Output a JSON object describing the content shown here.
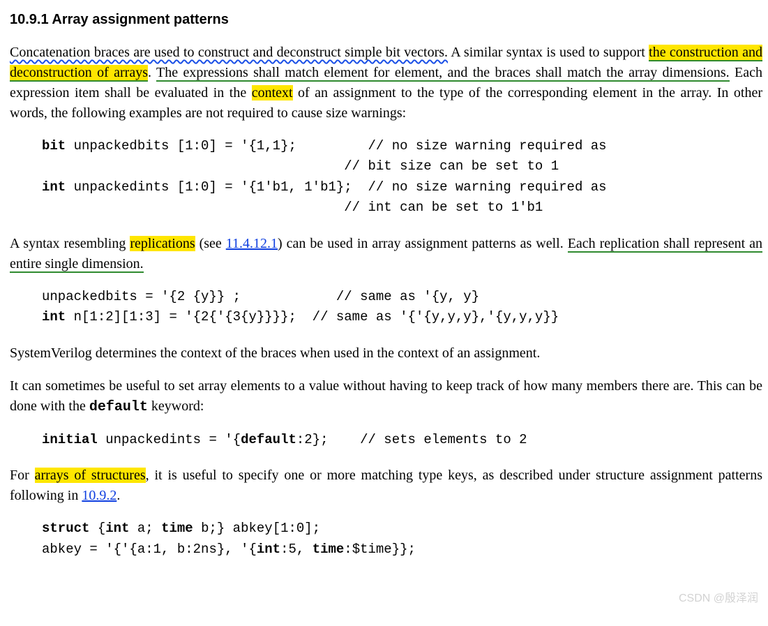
{
  "heading": "10.9.1 Array assignment patterns",
  "p1": {
    "s1": "Concatenation braces are used to construct and deconstruct simple bit vectors.",
    "s2a": " A similar syntax is used to support ",
    "s2h": "the construction and deconstruction of arrays",
    "s2b": ". ",
    "s3": "The expressions shall match element for element, and the braces shall match the array dimensions.",
    "s4a": " Each expression item shall be evaluated in the ",
    "s4h": "context",
    "s4b": " of an assignment to the type of the corresponding element in the array. In other words, the following examples are not required to cause size warnings:"
  },
  "code1": {
    "kw1": "bit",
    "l1": " unpackedbits [1:0] = '{1,1};         // no size warning required as",
    "l2": "                                      // bit size can be set to 1",
    "kw2": "int",
    "l3": " unpackedints [1:0] = '{1'b1, 1'b1};  // no size warning required as",
    "l4": "                                      // int can be set to 1'b1"
  },
  "p2": {
    "a": "A syntax resembling ",
    "h": "replications",
    "b": " (see ",
    "link": "11.4.12.1",
    "c": ") can be used in array assignment patterns as well. ",
    "u": "Each replication shall represent an entire single dimension.",
    "d": ""
  },
  "code2": {
    "l1": "unpackedbits = '{2 {y}} ;            // same as '{y, y}",
    "kw": "int",
    "l2": " n[1:2][1:3] = '{2{'{3{y}}}};  // same as '{'{y,y,y},'{y,y,y}}"
  },
  "p3": "SystemVerilog determines the context of the braces when used in the context of an assignment.",
  "p4a": "It can sometimes be useful to set array elements to a value without having to keep track of how many members there are. This can be done with the ",
  "p4kw": "default",
  "p4b": " keyword:",
  "code3": {
    "kw1": "initial",
    "mid": " unpackedints = '{",
    "kw2": "default",
    "end": ":2};    // sets elements to 2"
  },
  "p5": {
    "a": "For ",
    "h": "arrays of structures",
    "b": ", it is useful to specify one or more matching type keys, as described under structure assignment patterns following in ",
    "link": "10.9.2",
    "c": "."
  },
  "code4": {
    "kw1": "struct",
    "a": " {",
    "kw2": "int",
    "b": " a; ",
    "kw3": "time",
    "c": " b;} abkey[1:0];",
    "d": "abkey = '{'{a:1, b:2ns}, '{",
    "kw4": "int",
    "e": ":5, ",
    "kw5": "time",
    "f": ":$time}};"
  },
  "watermark": "CSDN @殷泽润"
}
